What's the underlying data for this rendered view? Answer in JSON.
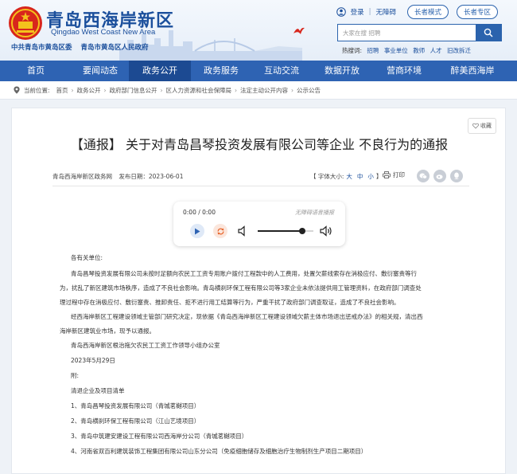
{
  "header": {
    "site_name": "青岛西海岸新区",
    "site_name_en": "Qingdao West Coast New Area",
    "sub_titles": [
      "中共青岛市黄岛区委",
      "青岛市黄岛区人民政府"
    ],
    "top_links": {
      "login": "登录",
      "separator": "|",
      "accessibility": "无障碍",
      "elder_mode": "长者模式",
      "elder_edition": "长者专区"
    },
    "search": {
      "placeholder": "大家在搜 招聘"
    },
    "hot_search": {
      "label": "热搜词:",
      "items": [
        "招聘",
        "事业单位",
        "教师",
        "人才",
        "旧改拆迁"
      ]
    }
  },
  "nav": {
    "items": [
      {
        "label": "首页"
      },
      {
        "label": "要闻动态"
      },
      {
        "label": "政务公开"
      },
      {
        "label": "政务服务"
      },
      {
        "label": "互动交流"
      },
      {
        "label": "数据开放"
      },
      {
        "label": "营商环境"
      },
      {
        "label": "醉美西海岸"
      }
    ],
    "active_index": 2
  },
  "breadcrumb": {
    "prefix": "当前位置:",
    "items": [
      "首页",
      "政务公开",
      "政府部门信息公开",
      "区人力资源和社会保障局",
      "法定主动公开内容",
      "公示公告"
    ]
  },
  "article": {
    "favorite": "收藏",
    "title": "【通报】 关于对青岛昌琴投资发展有限公司等企业 不良行为的通报",
    "source": "青岛西海岸新区政务网",
    "publish_date": "发布日期：2023-06-01",
    "font_size": {
      "open": "【 字体大小:",
      "big": "大",
      "mid": "中",
      "small": "小",
      "close": "】"
    },
    "print": "打印",
    "player": {
      "time": "0:00 / 0:00",
      "note": "无障碍语音播报",
      "volume_level": 0.8
    },
    "paragraphs": [
      "各有关单位:",
      "青岛昌琴投资发展有限公司未按时足额向农民工工资专用账户拨付工程款中的人工费用，处置欠薪线索存在消极应付、敷衍塞责等行",
      "为，扰乱了新区建筑市场秩序，造成了不良社会影响。青岛横刹环保工程有限公司等3家企业未依法提供用工管理资料，在政府部门调查处",
      "理过程中存在消极应付、敷衍塞责、推卸责任、拒不进行用工结算等行为，严重干扰了政府部门调查取证，造成了不良社会影响。",
      "经西海岸新区工程建设领域主管部门研究决定，现依据《青岛西海岸新区工程建设领域欠薪主体市场退出惩戒办法》的相关规，清出西",
      "海岸新区建筑业市场，现予以通报。",
      "青岛西海岸新区根治拖欠农民工工资工作领导小组办公室",
      "2023年5月29日",
      "附:",
      "清退企业及项目清单",
      "1、青岛昌琴投资发展有限公司（青城茗樾项目）",
      "2、青岛横刹环保工程有限公司（江山艺境项目）",
      "3、青岛中筑建安建设工程有限公司西海岸分公司（青城茗樾项目）",
      "4、河南省双百利建筑装饰工程集团有限公司山东分公司（免疫细胞储存及细胞治疗生物制剂生产项目二期项目）"
    ]
  },
  "colors": {
    "brand_blue": "#2e63b3",
    "nav_active": "#1c4a92",
    "title_blue": "#1b4f9c"
  }
}
